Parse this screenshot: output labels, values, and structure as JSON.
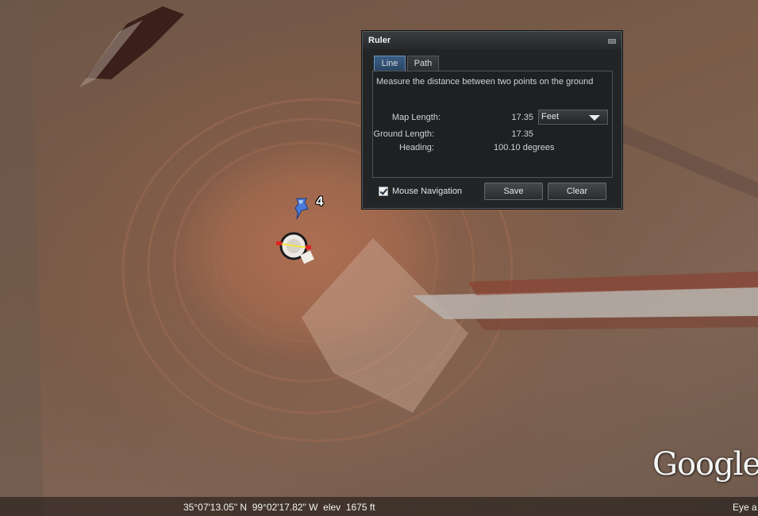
{
  "ruler": {
    "title": "Ruler",
    "tabs": [
      {
        "label": "Line",
        "active": true
      },
      {
        "label": "Path",
        "active": false
      }
    ],
    "description": "Measure the distance between two points on the ground",
    "map_length_label": "Map Length:",
    "map_length_value": "17.35",
    "units_selected": "Feet",
    "ground_length_label": "Ground Length:",
    "ground_length_value": "17.35",
    "heading_label": "Heading:",
    "heading_value": "100.10 degrees",
    "mouse_navigation_label": "Mouse Navigation",
    "mouse_navigation_checked": true,
    "save_label": "Save",
    "clear_label": "Clear"
  },
  "map": {
    "placemark_label": "4",
    "placemark_icon": "pushpin-icon",
    "pin_color": "#4a78d8",
    "ruler_line_color": "#f2e640",
    "ruler_endpoint_color": "#e02020"
  },
  "status_bar": {
    "coordinates": "35°07'13.05\" N  99°02'17.82\" W  elev  1675 ft",
    "eye_alt": "Eye a"
  },
  "logo": {
    "text": "Google"
  }
}
